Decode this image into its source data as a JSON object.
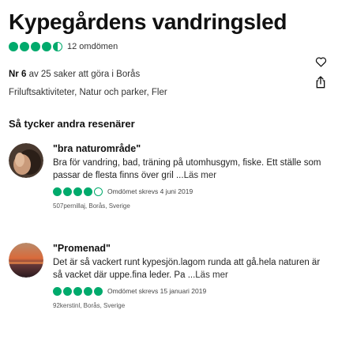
{
  "attraction": {
    "title": "Kypegårdens vandringsled",
    "rating": 4.5,
    "review_count": "12 omdömen",
    "rank_number": "Nr 6",
    "rank_text": " av 25 saker att göra i Borås",
    "categories": "Friluftsaktiviteter, Natur och parker, Fler"
  },
  "icons": {
    "favorite": "heart-icon",
    "share": "share-icon"
  },
  "colors": {
    "bubble": "#00aa6c"
  },
  "reviews_section": {
    "title": "Så tycker andra resenärer",
    "read_more": "Läs mer",
    "reviews": [
      {
        "title": "\"bra naturområde\"",
        "text": "Bra för vandring, bad, träning på utomhusgym, fiske. Ett ställe som passar de flesta finns över gril ...",
        "rating": 4,
        "date": "Omdömet skrevs 4 juni 2019",
        "author": "507pernillaj, Borås, Sverige"
      },
      {
        "title": "\"Promenad\"",
        "text": "Det är så vackert runt kypesjön.lagom runda att gå.hela naturen är så vacket där uppe.fina leder. Pa ...",
        "rating": 5,
        "date": "Omdömet skrevs 15 januari 2019",
        "author": "92kerstinl, Borås, Sverige"
      }
    ]
  }
}
